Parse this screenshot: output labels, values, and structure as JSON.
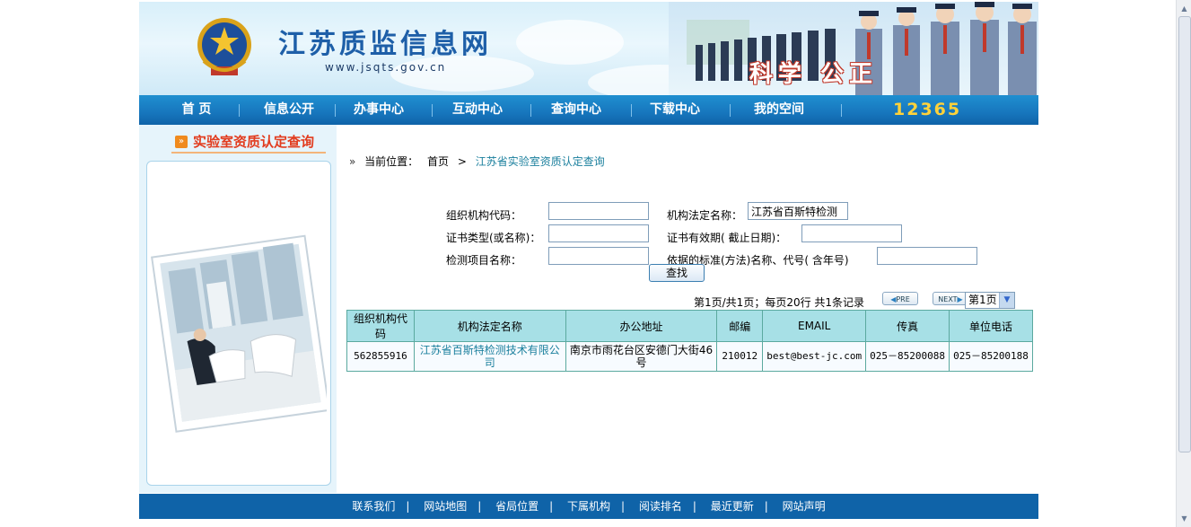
{
  "header": {
    "site_title": "江苏质监信息网",
    "site_url": "www.jsqts.gov.cn",
    "slogan": "科学 公正",
    "hotline": "12365"
  },
  "nav": {
    "items": [
      {
        "label": "首 页"
      },
      {
        "label": "信息公开"
      },
      {
        "label": "办事中心"
      },
      {
        "label": "互动中心"
      },
      {
        "label": "查询中心"
      },
      {
        "label": "下载中心"
      },
      {
        "label": "我的空间"
      }
    ]
  },
  "sidebar": {
    "title": "实验室资质认定查询"
  },
  "breadcrumb": {
    "prefix": "当前位置：",
    "home": "首页",
    "separator": ">",
    "current": "江苏省实验室资质认定查询"
  },
  "form": {
    "org_code_label": "组织机构代码：",
    "org_code_value": "",
    "legal_name_label": "机构法定名称：",
    "legal_name_value": "江苏省百斯特检测",
    "cert_type_label": "证书类型(或名称)：",
    "cert_type_value": "",
    "cert_validity_label": "证书有效期( 截止日期)：",
    "cert_validity_value": "",
    "test_item_label": "检测项目名称：",
    "test_item_value": "",
    "standard_label": "依据的标准(方法)名称、代号( 含年号)",
    "standard_value": "",
    "search_button": "查找"
  },
  "pager": {
    "info": "第1页/共1页；每页20行 共1条记录",
    "prev": "PRE",
    "next": "NEXT",
    "page_select": "第1页"
  },
  "table": {
    "headers": [
      "组织机构代码",
      "机构法定名称",
      "办公地址",
      "邮编",
      "EMAIL",
      "传真",
      "单位电话"
    ],
    "rows": [
      {
        "org_code": "562855916",
        "name": "江苏省百斯特检测技术有限公司",
        "address": "南京市雨花台区安德门大街46号",
        "postcode": "210012",
        "email": "best@best-jc.com",
        "fax": "025－85200088",
        "phone": "025－85200188"
      }
    ]
  },
  "footer": {
    "links": [
      "联系我们",
      "网站地图",
      "省局位置",
      "下属机构",
      "阅读排名",
      "最近更新",
      "网站声明"
    ],
    "separator": "|"
  },
  "colors": {
    "nav_blue": "#1776bd",
    "footer_blue": "#0f63a8",
    "table_header": "#a7e0e6",
    "link_teal": "#1a7f9d",
    "sidebar_title_red": "#e23b1d"
  }
}
